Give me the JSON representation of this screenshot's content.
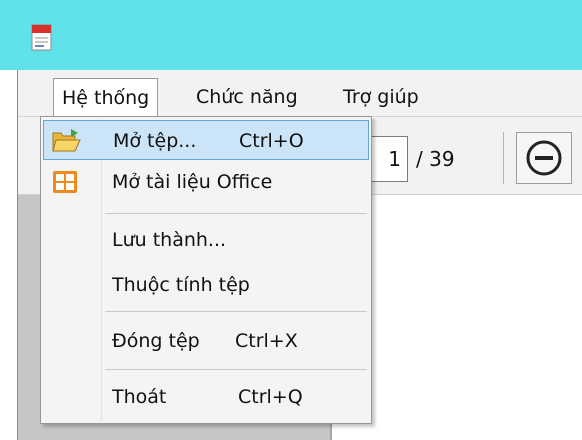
{
  "menubar": {
    "items": [
      "Hệ thống",
      "Chức năng",
      "Trợ giúp"
    ]
  },
  "toolbar": {
    "page_number": "1",
    "page_total": "/ 39",
    "zoom_out_icon": "minus-circle-icon"
  },
  "dropdown": {
    "items": [
      {
        "label": "Mở tệp...",
        "shortcut": "Ctrl+O",
        "icon": "folder-open-icon",
        "highlighted": true
      },
      {
        "label": "Mở tài liệu Office",
        "shortcut": "",
        "icon": "office-document-icon"
      },
      {
        "label": "Lưu thành...",
        "shortcut": ""
      },
      {
        "label": "Thuộc tính tệp",
        "shortcut": ""
      },
      {
        "label": "Đóng tệp",
        "shortcut": "Ctrl+X"
      },
      {
        "label": "Thoát",
        "shortcut": "Ctrl+Q"
      }
    ]
  },
  "colors": {
    "titlebar": "#5fe2ea",
    "highlight_bg": "#cce4f7",
    "highlight_border": "#5da6dc",
    "pane_gray": "#c6c6c6"
  }
}
